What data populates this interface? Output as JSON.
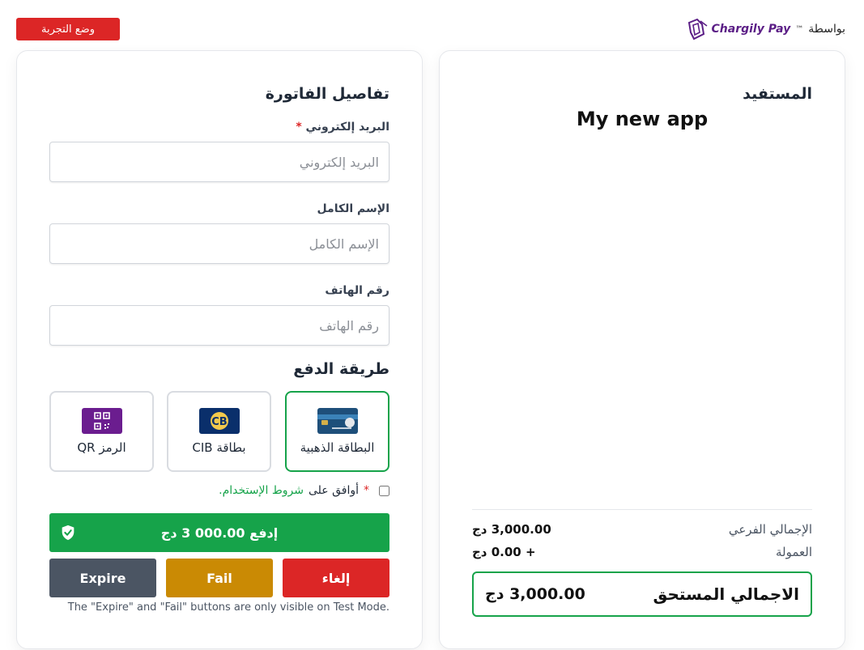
{
  "header": {
    "test_mode_label": "وضع التجربة",
    "powered_by": "بواسطة",
    "brand_name": "Chargily Pay",
    "brand_tm": "™"
  },
  "billing": {
    "title": "تفاصيل الفاتورة",
    "email": {
      "label": "البريد إلكتروني",
      "required_mark": "*",
      "placeholder": "البريد إلكتروني",
      "value": ""
    },
    "full_name": {
      "label": "الإسم الكامل",
      "placeholder": "الإسم الكامل",
      "value": ""
    },
    "phone": {
      "label": "رقم الهاتف",
      "placeholder": "رقم الهاتف",
      "value": ""
    }
  },
  "payment": {
    "title": "طريقة الدفع",
    "methods": [
      {
        "label": "البطاقة الذهبية",
        "icon": "edahabia-card-icon",
        "selected": true
      },
      {
        "label": "بطاقة CIB",
        "icon": "cib-card-icon",
        "selected": false
      },
      {
        "label": "الرمز QR",
        "icon": "qr-code-icon",
        "selected": false
      }
    ],
    "terms_prefix": "أوافق على",
    "terms_link": "شروط الإستخدام.",
    "terms_required_mark": "*",
    "pay_button": "إدفع 000.00 3 دج",
    "cancel_button": "إلغاء",
    "fail_button": "Fail",
    "expire_button": "Expire",
    "test_note": "The \"Expire\" and \"Fail\" buttons are only visible on Test Mode."
  },
  "summary": {
    "merchant_title": "المستفيد",
    "app_name": "My new app",
    "subtotal_label": "الإجمالي الفرعي",
    "subtotal_value": "3,000.00 دج",
    "fee_label": "العمولة",
    "fee_value": "+ 0.00 دج",
    "total_label": "الاجمالي المستحق",
    "total_value": "3,000.00 دج"
  },
  "colors": {
    "accent_green": "#16a34a",
    "danger_red": "#dc2626",
    "warning_amber": "#ca8a04",
    "neutral_gray": "#4b5563",
    "brand_purple": "#5b1e86"
  }
}
